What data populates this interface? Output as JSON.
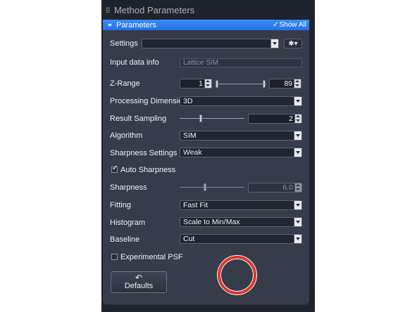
{
  "window": {
    "title": "Method Parameters"
  },
  "panel": {
    "title": "Parameters",
    "show_all": "Show All"
  },
  "settings": {
    "label": "Settings",
    "value": ""
  },
  "input_data_info": {
    "label": "Input data info",
    "value": "Lattice SIM"
  },
  "z_range": {
    "label": "Z-Range",
    "min": "1",
    "max": "89"
  },
  "processing_dimension": {
    "label": "Processing Dimension",
    "value": "3D"
  },
  "result_sampling": {
    "label": "Result Sampling",
    "value": "2"
  },
  "algorithm": {
    "label": "Algorithm",
    "value": "SIM"
  },
  "sharpness_settings": {
    "label": "Sharpness Settings",
    "value": "Weak"
  },
  "auto_sharpness": {
    "label": "Auto Sharpness",
    "checked": true
  },
  "sharpness": {
    "label": "Sharpness",
    "value": "6.0"
  },
  "fitting": {
    "label": "Fitting",
    "value": "Fast Fit"
  },
  "histogram": {
    "label": "Histogram",
    "value": "Scale to Min/Max"
  },
  "baseline": {
    "label": "Baseline",
    "value": "Cut"
  },
  "experimental_psf": {
    "label": "Experimental PSF",
    "checked": false
  },
  "defaults_button": {
    "label": "Defaults"
  },
  "colors": {
    "accent": "#2f80f0",
    "panel": "#363c4a",
    "highlight_ring": "#e0382c"
  },
  "icons": {
    "gear": "gear-icon",
    "undo": "undo-icon",
    "collapse": "collapse-triangle-icon"
  }
}
